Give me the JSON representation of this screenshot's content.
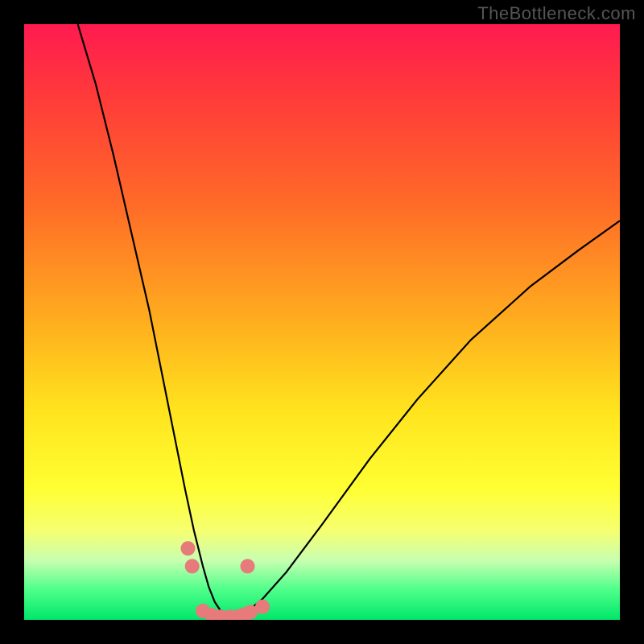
{
  "watermark": "TheBottleneck.com",
  "colors": {
    "background": "#000000",
    "curve": "#000000",
    "dots": "#e77a7a",
    "gradient_top": "#ff1a50",
    "gradient_bottom": "#00e66a"
  },
  "chart_data": {
    "type": "line",
    "title": "",
    "xlabel": "",
    "ylabel": "",
    "xlim": [
      0,
      100
    ],
    "ylim": [
      0,
      100
    ],
    "grid": false,
    "legend": false,
    "series": [
      {
        "name": "left-curve",
        "x": [
          9,
          12,
          15,
          18,
          21,
          23,
          25,
          27,
          28.5,
          30,
          31,
          32,
          33,
          34,
          35
        ],
        "y": [
          100,
          90,
          78,
          65,
          52,
          42,
          32,
          22,
          15,
          9,
          5.5,
          3,
          1.5,
          0.7,
          0.3
        ]
      },
      {
        "name": "right-curve",
        "x": [
          35,
          37,
          40,
          44,
          50,
          58,
          66,
          75,
          85,
          93,
          100
        ],
        "y": [
          0.3,
          1.0,
          3.5,
          8,
          16,
          27,
          37,
          47,
          56,
          62,
          67
        ]
      }
    ],
    "dots": [
      {
        "x": 27.5,
        "y": 12
      },
      {
        "x": 28.2,
        "y": 9
      },
      {
        "x": 30,
        "y": 1.5
      },
      {
        "x": 31.5,
        "y": 0.8
      },
      {
        "x": 33,
        "y": 0.5
      },
      {
        "x": 34.5,
        "y": 0.5
      },
      {
        "x": 36,
        "y": 0.6
      },
      {
        "x": 37,
        "y": 0.9
      },
      {
        "x": 38,
        "y": 1.3
      },
      {
        "x": 40,
        "y": 2.2
      },
      {
        "x": 37.5,
        "y": 9
      }
    ]
  }
}
